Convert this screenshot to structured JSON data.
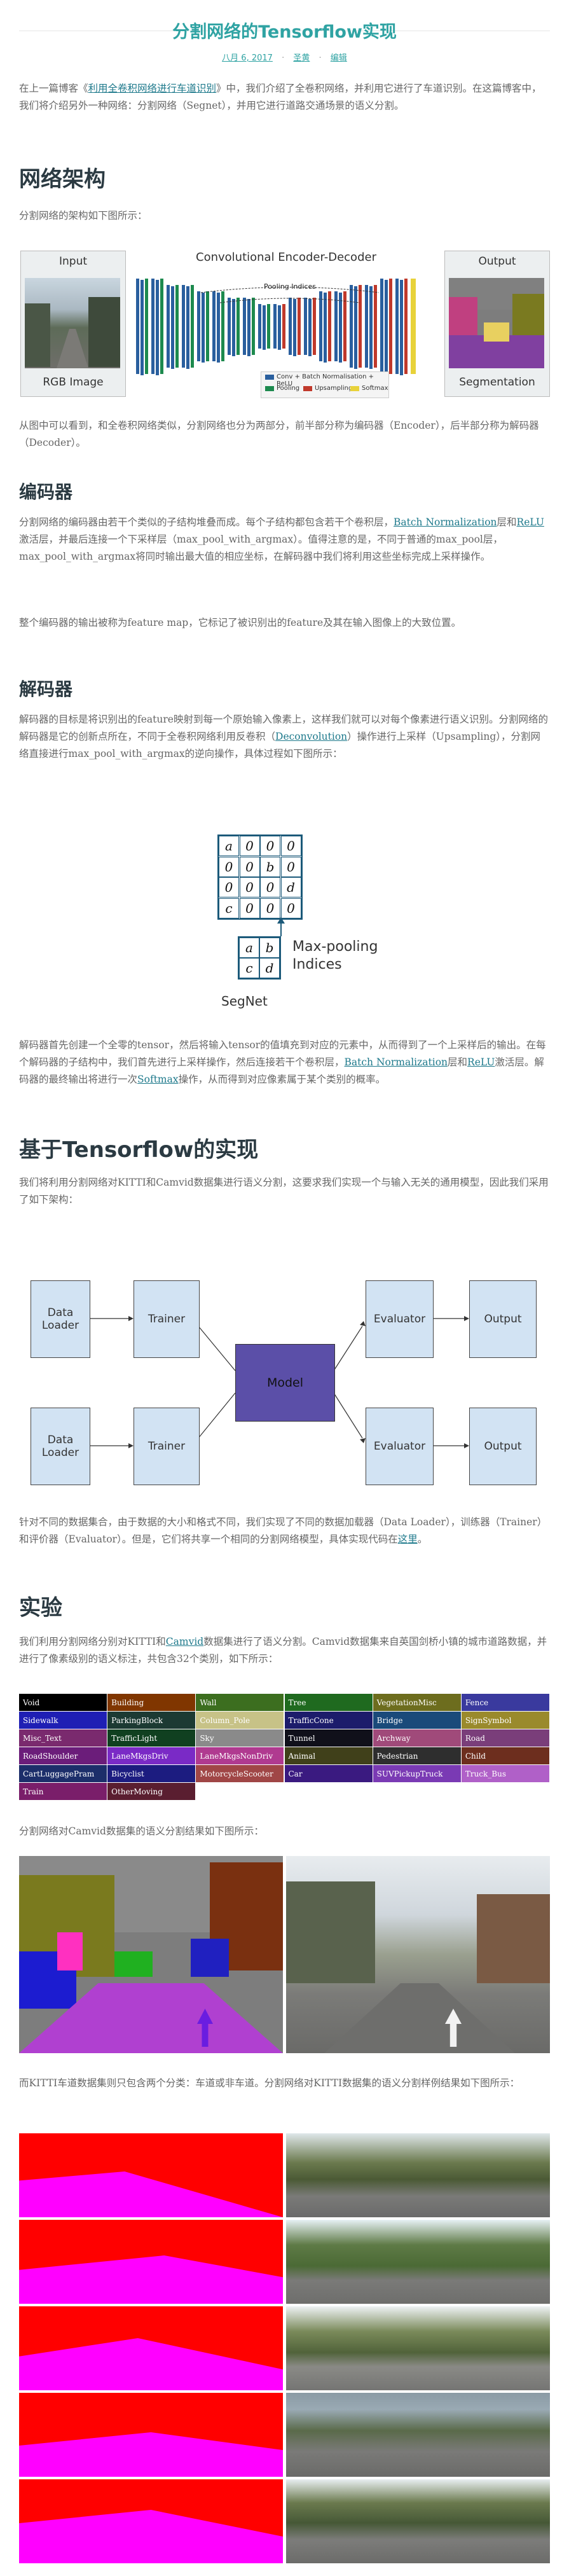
{
  "header": {
    "title": "分割网络的Tensorflow实现",
    "date": "八月 6, 2017",
    "sep": "·",
    "author": "圣黄",
    "edit": "编辑"
  },
  "intro": {
    "p1_a": "在上一篇博客《",
    "p1_link": "利用全卷积网络进行车道识别",
    "p1_b": "》中，我们介绍了全卷积网络，并利用它进行了车道识别。在这篇博客中，我们将介绍另外一种网络：分割网络（Segnet），并用它进行道路交通场景的语义分割。"
  },
  "arch": {
    "heading": "网络架构",
    "p": "分割网络的架构如下图所示：",
    "fig": {
      "input_label": "Input",
      "output_label": "Output",
      "center_title": "Convolutional Encoder-Decoder",
      "pooling": "Pooling Indices",
      "rgb": "RGB Image",
      "seg": "Segmentation",
      "legend": [
        "Conv + Batch Normalisation + ReLU",
        "Pooling",
        "Upsampling",
        "Softmax"
      ],
      "legend_colors": [
        "#2a5f9e",
        "#1d8a4e",
        "#c0392b",
        "#e8d23a"
      ]
    },
    "p2": "从图中可以看到，和全卷积网络类似，分割网络也分为两部分，前半部分称为编码器（Encoder），后半部分称为解码器（Decoder）。"
  },
  "encoder": {
    "heading": "编码器",
    "p1_a": "分割网络的编码器由若干个类似的子结构堆叠而成。每个子结构都包含若干个卷积层，",
    "p1_link1": "Batch Normalization",
    "p1_b": "层和",
    "p1_link2": "ReLU",
    "p1_c": "激活层，并最后连接一个下采样层（max_pool_with_argmax）。值得注意的是，不同于普通的max_pool层，max_pool_with_argmax将同时输出最大值的相应坐标，在解码器中我们将利用这些坐标完成上采样操作。",
    "p2": "整个编码器的输出被称为feature map，它标记了被识别出的feature及其在输入图像上的大致位置。"
  },
  "decoder": {
    "heading": "解码器",
    "p1_a": "解码器的目标是将识别出的feature映射到每一个原始输入像素上，这样我们就可以对每个像素进行语义识别。分割网络的解码器是它的创新点所在，不同于全卷积网络利用反卷积（",
    "p1_link": "Deconvolution",
    "p1_b": "）操作进行上采样（Upsampling），分割网络直接进行max_pool_with_argmax的逆向操作，具体过程如下图所示：",
    "fig": {
      "matrix": [
        [
          "a",
          "0",
          "0",
          "0"
        ],
        [
          "0",
          "0",
          "b",
          "0"
        ],
        [
          "0",
          "0",
          "0",
          "d"
        ],
        [
          "c",
          "0",
          "0",
          "0"
        ]
      ],
      "small": [
        [
          "a",
          "b"
        ],
        [
          "c",
          "d"
        ]
      ],
      "label1": "Max-pooling",
      "label2": "Indices",
      "caption": "SegNet"
    },
    "p2_a": "解码器首先创建一个全零的tensor，然后将输入tensor的值填充到对应的元素中，从而得到了一个上采样后的输出。在每个解码器的子结构中，我们首先进行上采样操作，然后连接若干个卷积层，",
    "p2_link1": "Batch Normalization",
    "p2_b": "层和",
    "p2_link2": "ReLU",
    "p2_c": "激活层。解码器的最终输出将进行一次",
    "p2_link3": "Softmax",
    "p2_d": "操作，从而得到对应像素属于某个类别的概率。"
  },
  "impl": {
    "heading": "基于Tensorflow的实现",
    "p": "我们将利用分割网络对KITTI和Camvid数据集进行语义分割，这要求我们实现一个与输入无关的通用模型，因此我们采用了如下架构：",
    "fig": {
      "loader": [
        "Data",
        "Loader"
      ],
      "trainer": "Trainer",
      "model": "Model",
      "evaluator": "Evaluator",
      "output": "Output"
    },
    "p2_a": "针对不同的数据集合，由于数据的大小和格式不同，我们实现了不同的数据加载器（Data Loader），训练器（Trainer）和评价器（Evaluator）。但是，它们将共享一个相同的分割网络模型，具体实现代码在",
    "p2_link": "这里",
    "p2_b": "。"
  },
  "exp": {
    "heading": "实验",
    "p_a": "我们利用分割网络分别对KITTI和",
    "p_link": "Camvid",
    "p_b": "数据集进行了语义分割。Camvid数据集来自英国剑桥小镇的城市道路数据，并进行了像素级别的语义标注，共包含32个类别，如下所示：",
    "classes": [
      [
        "Void",
        "#000000"
      ],
      [
        "Building",
        "#803600"
      ],
      [
        "Wall",
        "#3c6e1f"
      ],
      [
        "Tree",
        "#1f6a1f"
      ],
      [
        "VegetationMisc",
        "#6d6d1e"
      ],
      [
        "Fence",
        "#3a3a9e"
      ],
      [
        "Sidewalk",
        "#1f1fb4"
      ],
      [
        "ParkingBlock",
        "#1c3a33"
      ],
      [
        "Column_Pole",
        "#c7c287"
      ],
      [
        "TrafficCone",
        "#1c1c6b"
      ],
      [
        "Bridge",
        "#1a4a7a"
      ],
      [
        "SignSymbol",
        "#9a8a2c"
      ],
      [
        "Misc_Text",
        "#7a2a6e"
      ],
      [
        "TrafficLight",
        "#104020"
      ],
      [
        "Sky",
        "#8a8a8a"
      ],
      [
        "Tunnel",
        "#10101a"
      ],
      [
        "Archway",
        "#a04a7a"
      ],
      [
        "Road",
        "#7a3e7a"
      ],
      [
        "RoadShoulder",
        "#6b1d7a"
      ],
      [
        "LaneMkgsDriv",
        "#7a2ac6"
      ],
      [
        "LaneMkgsNonDriv",
        "#b03a90"
      ],
      [
        "Animal",
        "#40401a"
      ],
      [
        "Pedestrian",
        "#2e2e2e"
      ],
      [
        "Child",
        "#6d2e1e"
      ],
      [
        "CartLuggagePram",
        "#1c2e6a"
      ],
      [
        "Bicyclist",
        "#1c1c80"
      ],
      [
        "MotorcycleScooter",
        "#a04646"
      ],
      [
        "Car",
        "#3a1a80"
      ],
      [
        "SUVPickupTruck",
        "#7a3ab4"
      ],
      [
        "Truck_Bus",
        "#b060c8"
      ],
      [
        "Train",
        "#7a1e6a"
      ],
      [
        "OtherMoving",
        "#5a1e30"
      ]
    ],
    "p2": "分割网络对Camvid数据集的语义分割结果如下图所示：",
    "p3": "而KITTI车道数据集则只包含两个分类：车道或非车道。分割网络对KITTI数据集的语义分割样例结果如下图所示："
  }
}
